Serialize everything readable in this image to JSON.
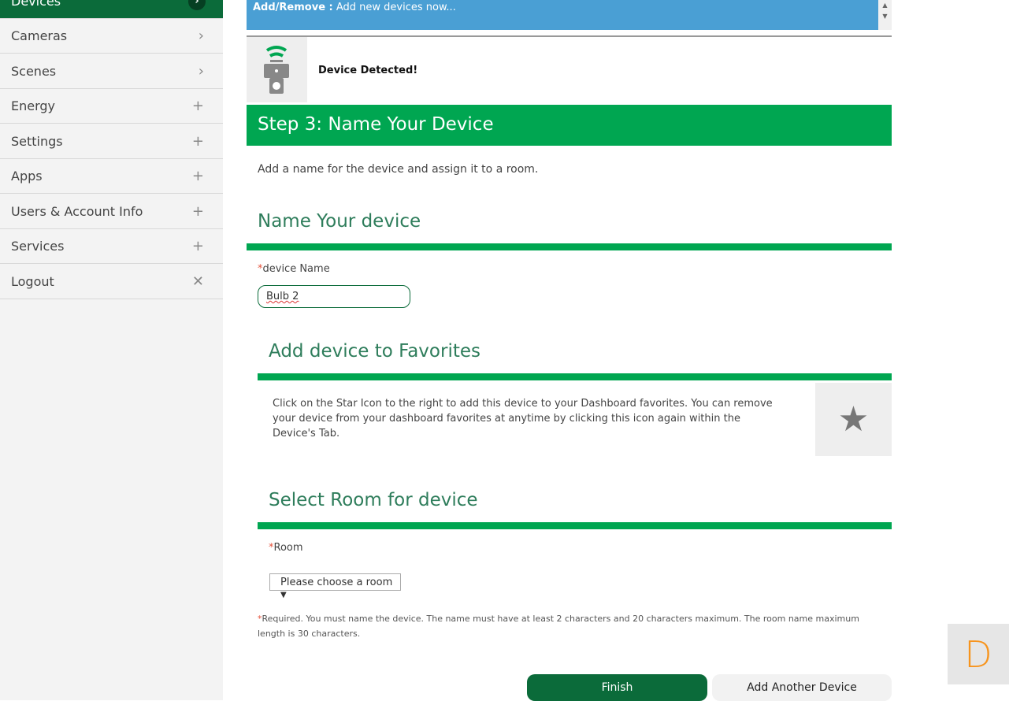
{
  "sidebar": {
    "items": [
      {
        "label": "Devices",
        "icon": "chevron-right"
      },
      {
        "label": "Cameras",
        "icon": "chevron-right"
      },
      {
        "label": "Scenes",
        "icon": "chevron-right"
      },
      {
        "label": "Energy",
        "icon": "plus"
      },
      {
        "label": "Settings",
        "icon": "plus"
      },
      {
        "label": "Apps",
        "icon": "plus"
      },
      {
        "label": "Users & Account Info",
        "icon": "plus"
      },
      {
        "label": "Services",
        "icon": "plus"
      },
      {
        "label": "Logout",
        "icon": "close"
      }
    ]
  },
  "banner": {
    "label": "Add/Remove :",
    "text": " Add new devices now..."
  },
  "detected": "Device Detected!",
  "step_title": "Step 3: Name Your Device",
  "step_desc": "Add a name for the device and assign it to a room.",
  "name_section": {
    "title": "Name Your device",
    "field_label": "device Name",
    "value": "Bulb 2"
  },
  "fav_section": {
    "title": "Add device to Favorites",
    "text": "Click on the Star Icon to the right to add this device to your Dashboard favorites. You can remove your device from your dashboard favorites at anytime by clicking this icon again within the Device's Tab."
  },
  "room_section": {
    "title": "Select Room for device",
    "field_label": "Room",
    "selected": "Please choose a room"
  },
  "required_note": "Required. You must name the device. The name must have at least 2 characters and 20 characters maximum. The room name maximum length is 30 characters.",
  "buttons": {
    "finish": "Finish",
    "add_another": "Add Another Device"
  },
  "floating_letter": "D",
  "colors": {
    "green": "#00a651",
    "dark_green": "#0b6b3a",
    "blue": "#4a9fd4",
    "orange": "#f7941d"
  }
}
